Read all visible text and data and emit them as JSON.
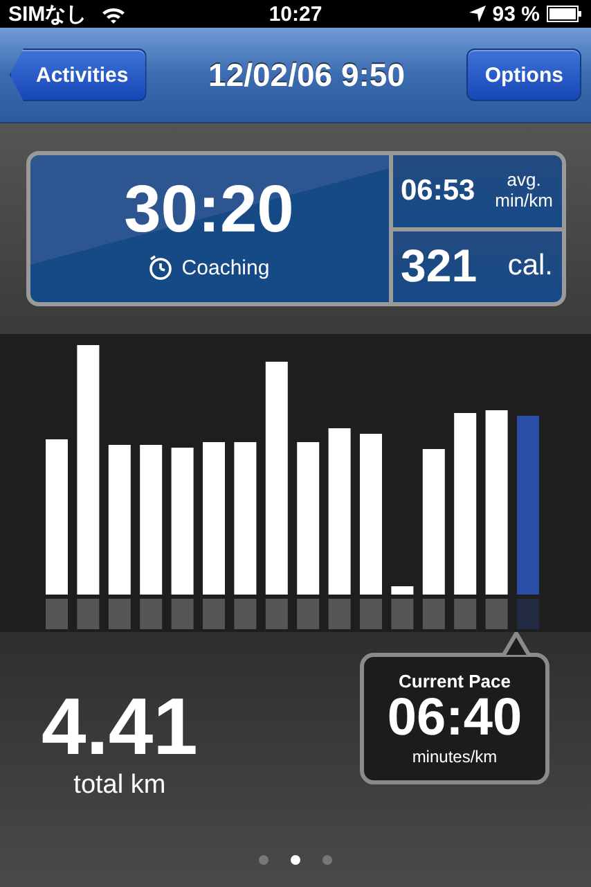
{
  "status_bar": {
    "carrier": "SIMなし",
    "time": "10:27",
    "battery": "93 %"
  },
  "nav_bar": {
    "back_button": "Activities",
    "title": "12/02/06 9:50",
    "right_button": "Options"
  },
  "summary": {
    "duration": "30:20",
    "coaching": "Coaching",
    "avg_pace": "06:53",
    "avg_label": "avg.",
    "avg_unit": "min/km",
    "calories": "321",
    "calories_unit": "cal."
  },
  "distance": {
    "value": "4.41",
    "unit": "total km"
  },
  "current_pace": {
    "label": "Current Pace",
    "value": "06:40",
    "unit": "minutes/km"
  },
  "pages": [
    {
      "selected": false
    },
    {
      "selected": true
    },
    {
      "selected": false
    }
  ]
}
